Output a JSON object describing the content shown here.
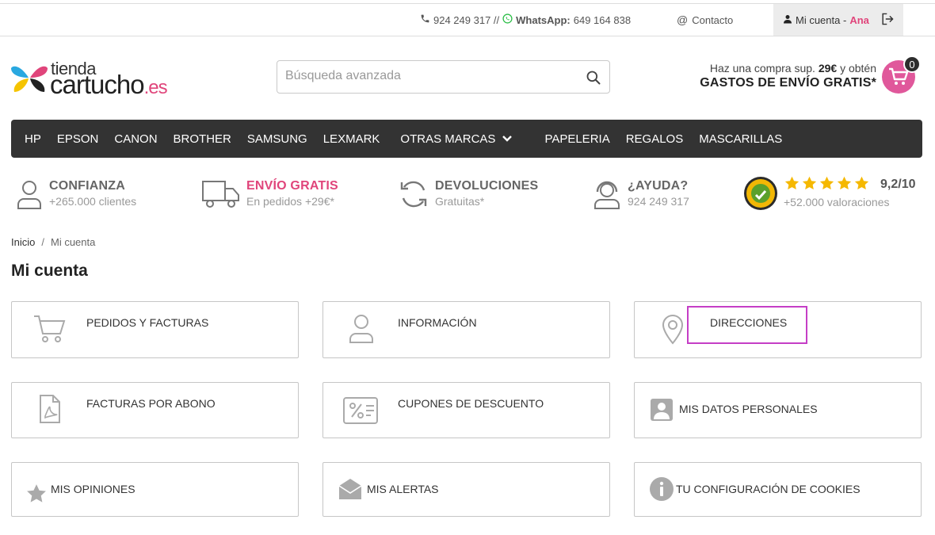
{
  "topbar": {
    "phone": "924 249 317 //",
    "whatsapp_label": "WhatsApp:",
    "whatsapp_number": "649 164 838",
    "contact": "Contacto",
    "account_label": "Mi cuenta -",
    "account_user": "Ana"
  },
  "header": {
    "logo_top": "tienda",
    "logo_main": "cartucho",
    "logo_tld": ".es",
    "search_placeholder": "Búsqueda avanzada",
    "ship_line1_pre": "Haz una compra sup.",
    "ship_line1_amount": "29€",
    "ship_line1_post": "y obtén",
    "ship_line2": "GASTOS DE ENVÍO GRATIS*",
    "cart_count": "0"
  },
  "nav": {
    "items": [
      "HP",
      "EPSON",
      "CANON",
      "BROTHER",
      "SAMSUNG",
      "LEXMARK"
    ],
    "more": "OTRAS MARCAS",
    "extra": [
      "PAPELERIA",
      "REGALOS",
      "MASCARILLAS"
    ]
  },
  "features": {
    "trust_title": "CONFIANZA",
    "trust_sub": "+265.000 clientes",
    "ship_title": "ENVÍO GRATIS",
    "ship_sub": "En pedidos +29€*",
    "returns_title": "DEVOLUCIONES",
    "returns_sub": "Gratuitas*",
    "help_title": "¿AYUDA?",
    "help_sub": "924 249 317",
    "rating_score": "9,2/10",
    "rating_count": "+52.000 valoraciones"
  },
  "breadcrumb": {
    "home": "Inicio",
    "sep": "/",
    "current": "Mi cuenta"
  },
  "page_title": "Mi cuenta",
  "cards": {
    "orders": "PEDIDOS Y FACTURAS",
    "info": "INFORMACIÓN",
    "addresses": "DIRECCIONES",
    "credit_slips": "FACTURAS POR ABONO",
    "vouchers": "CUPONES DE DESCUENTO",
    "personal_data": "MIS DATOS PERSONALES",
    "reviews": "MIS OPINIONES",
    "alerts": "MIS ALERTAS",
    "cookies": "TU CONFIGURACIÓN DE COOKIES"
  },
  "colors": {
    "brand_pink": "#e0457b",
    "nav_bg": "#333333",
    "highlight": "#c53ec6",
    "star": "#f5b800"
  }
}
